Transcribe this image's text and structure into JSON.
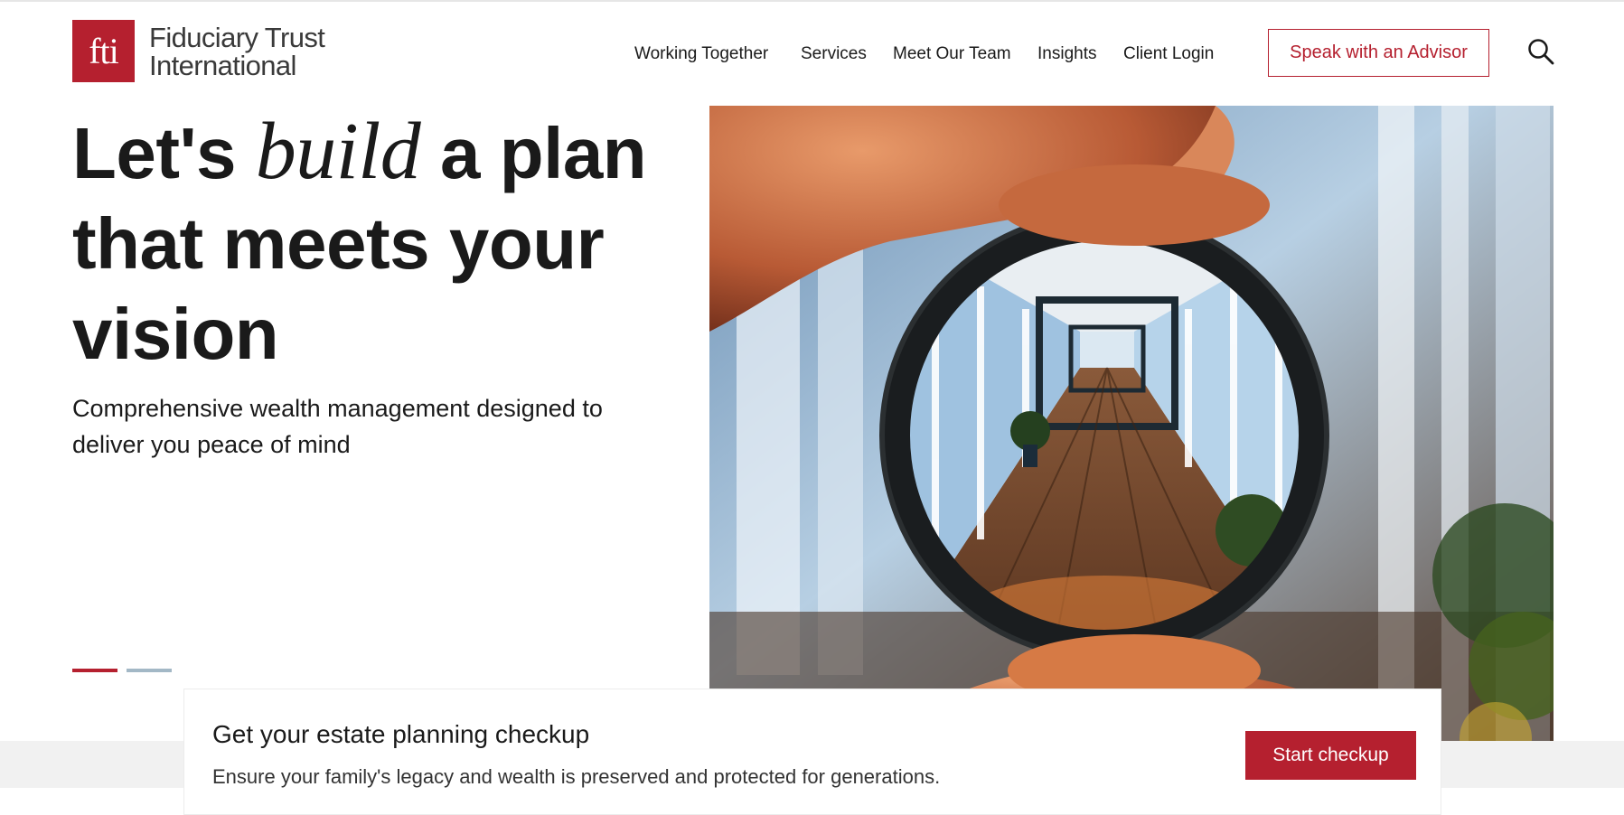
{
  "brand": {
    "mark": "fti",
    "name_line1": "Fiduciary Trust",
    "name_line2": "International",
    "accent": "#b5202f"
  },
  "nav": {
    "items": [
      {
        "label": "Working Together"
      },
      {
        "label": "Services"
      },
      {
        "label": "Meet Our Team"
      },
      {
        "label": "Insights"
      },
      {
        "label": "Client Login"
      }
    ],
    "cta_label": "Speak with an Advisor",
    "search_icon": "search-icon"
  },
  "hero": {
    "title_part1": "Let's",
    "title_italic": "build",
    "title_part2": "a plan that meets your vision",
    "subtitle": "Comprehensive wealth management designed to deliver you peace of mind",
    "slides": {
      "count": 2,
      "active": 1,
      "active_color": "#b5202f",
      "inactive_color": "#a3b8c6"
    },
    "image_icon": "magnifying-lens-hallway-photo"
  },
  "checkup": {
    "title": "Get your estate planning checkup",
    "description": "Ensure your family's legacy and wealth is preserved and protected for generations.",
    "button_label": "Start checkup"
  }
}
